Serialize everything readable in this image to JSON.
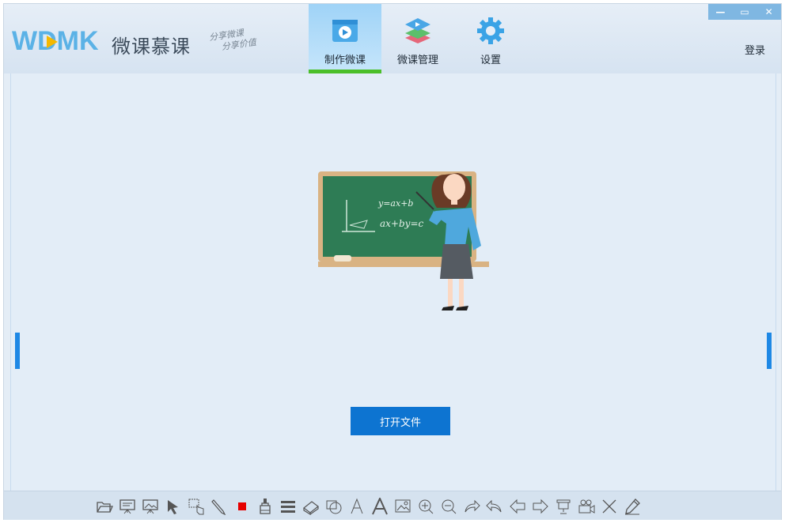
{
  "logo": {
    "wordmark": "WDMK",
    "name": "微课慕课",
    "slogan_line1": "分享微课",
    "slogan_line2": "分享价值"
  },
  "tabs": [
    {
      "label": "制作微课",
      "icon": "film-play-icon",
      "active": true
    },
    {
      "label": "微课管理",
      "icon": "layers-play-icon",
      "active": false
    },
    {
      "label": "设置",
      "icon": "gear-icon",
      "active": false
    }
  ],
  "window_controls": {
    "minimize": "—",
    "maximize": "▭",
    "close": "✕"
  },
  "login_label": "登录",
  "board": {
    "line1": "y=ax+b",
    "line2": "ax+by=c"
  },
  "open_file_label": "打开文件",
  "toolbar_icons": [
    "open-folder-icon",
    "presentation-board-icon",
    "image-board-icon",
    "pointer-icon",
    "hand-select-icon",
    "pen-icon",
    "color-swatch-icon",
    "brush-icon",
    "line-weight-icon",
    "eraser-icon",
    "shape-clear-icon",
    "text-thin-icon",
    "text-bold-icon",
    "insert-image-icon",
    "zoom-in-icon",
    "zoom-out-icon",
    "redo-icon",
    "undo-icon",
    "prev-page-icon",
    "next-page-icon",
    "projector-icon",
    "camera-icon",
    "clear-icon",
    "edit-icon"
  ],
  "colors": {
    "accent": "#0d74d1",
    "active_tab_underline": "#4bbf2a",
    "swatch": "#e60000"
  }
}
